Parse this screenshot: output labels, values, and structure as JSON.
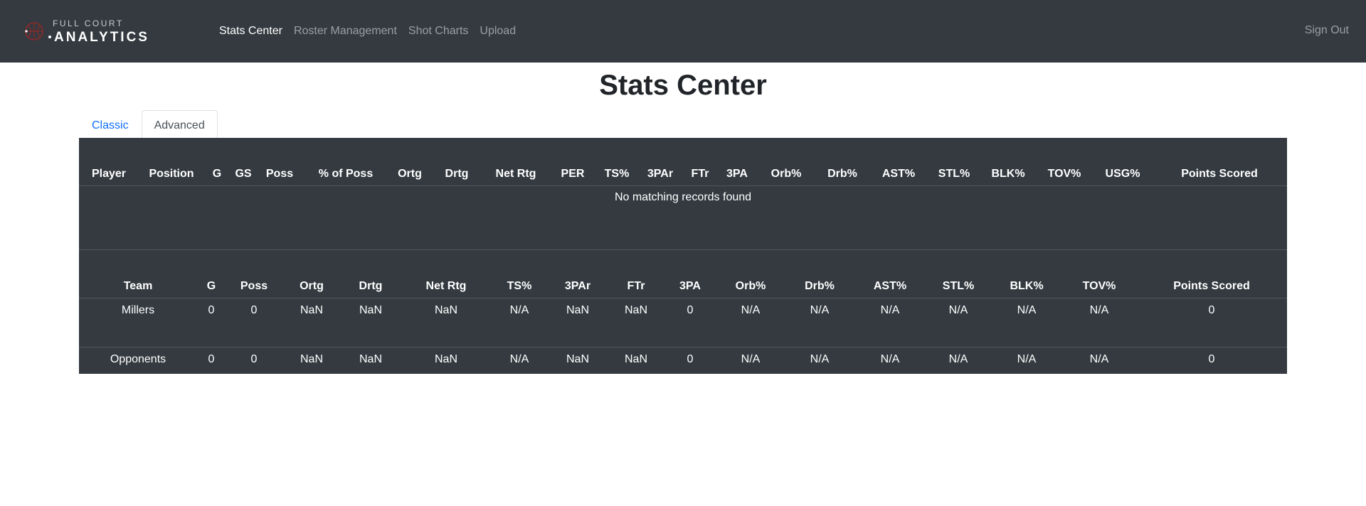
{
  "brand": {
    "top": "FULL COURT",
    "bottom": "ANALYTICS",
    "logo_icon": "basketball-icon"
  },
  "nav": {
    "links": [
      {
        "label": "Stats Center",
        "active": true
      },
      {
        "label": "Roster Management",
        "active": false
      },
      {
        "label": "Shot Charts",
        "active": false
      },
      {
        "label": "Upload",
        "active": false
      }
    ],
    "sign_out": "Sign Out"
  },
  "page": {
    "title": "Stats Center"
  },
  "tabs": [
    {
      "label": "Classic",
      "active": false
    },
    {
      "label": "Advanced",
      "active": true
    }
  ],
  "player_table": {
    "columns": [
      "Player",
      "Position",
      "G",
      "GS",
      "Poss",
      "% of Poss",
      "Ortg",
      "Drtg",
      "Net Rtg",
      "PER",
      "TS%",
      "3PAr",
      "FTr",
      "3PA",
      "Orb%",
      "Drb%",
      "AST%",
      "STL%",
      "BLK%",
      "TOV%",
      "USG%",
      "Points Scored"
    ],
    "empty_message": "No matching records found"
  },
  "team_table": {
    "columns": [
      "Team",
      "G",
      "Poss",
      "Ortg",
      "Drtg",
      "Net Rtg",
      "TS%",
      "3PAr",
      "FTr",
      "3PA",
      "Orb%",
      "Drb%",
      "AST%",
      "STL%",
      "BLK%",
      "TOV%",
      "Points Scored"
    ],
    "rows": [
      [
        "Millers",
        "0",
        "0",
        "NaN",
        "NaN",
        "NaN",
        "N/A",
        "NaN",
        "NaN",
        "0",
        "N/A",
        "N/A",
        "N/A",
        "N/A",
        "N/A",
        "N/A",
        "0"
      ],
      [
        "Opponents",
        "0",
        "0",
        "NaN",
        "NaN",
        "NaN",
        "N/A",
        "NaN",
        "NaN",
        "0",
        "N/A",
        "N/A",
        "N/A",
        "N/A",
        "N/A",
        "N/A",
        "0"
      ]
    ]
  },
  "colors": {
    "navbar_bg": "#343a40",
    "table_bg": "#343a40",
    "link_blue": "#0d6efd",
    "nav_active": "#ffffff",
    "nav_inactive": "#9a9da0"
  }
}
